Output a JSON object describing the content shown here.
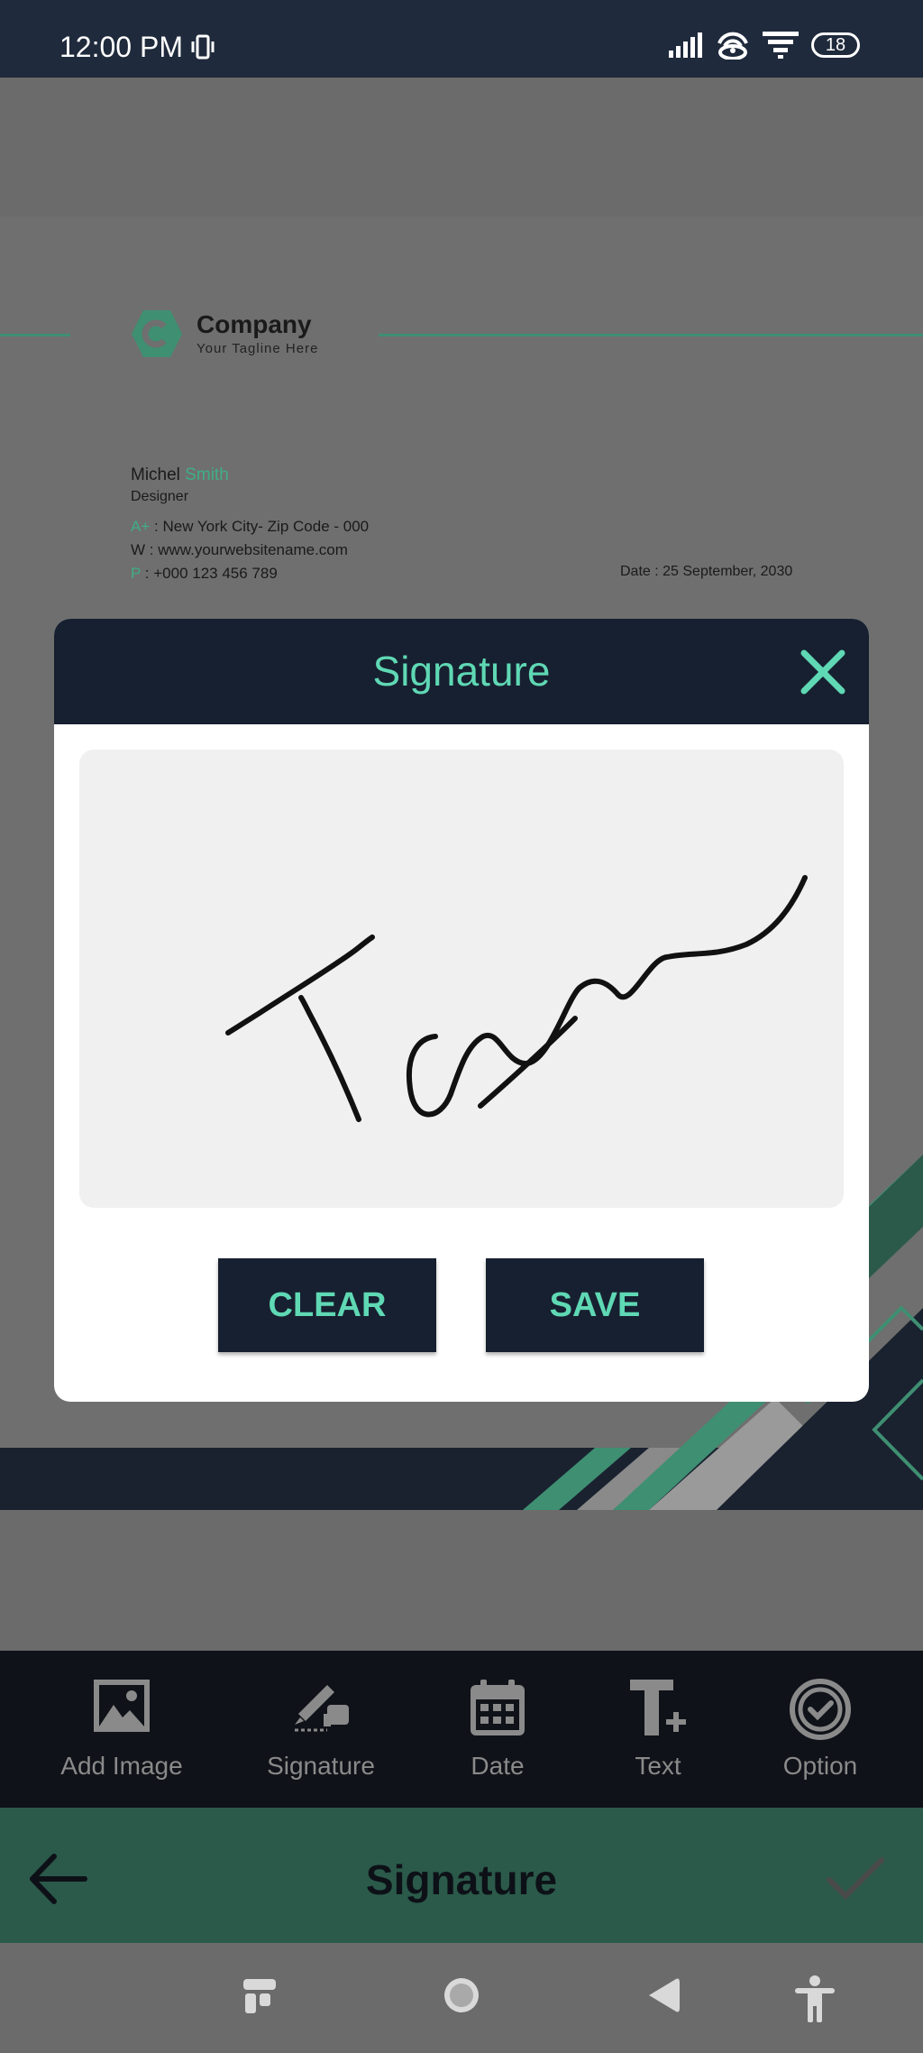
{
  "status_bar": {
    "time": "12:00 PM",
    "battery": "18",
    "icons": [
      "vibrate-icon",
      "signal-icon",
      "hotspot-icon",
      "wifi-icon",
      "battery-icon"
    ]
  },
  "document": {
    "company": "Company",
    "tagline": "Your Tagline Here",
    "name_first": "Michel",
    "name_last": "Smith",
    "role": "Designer",
    "address_key": "A+",
    "address": ": New York City- Zip Code - 000",
    "web_key": "W",
    "web": ": www.yourwebsitename.com",
    "phone_key": "P",
    "phone": ": +000 123 456 789",
    "date": "Date : 25 September, 2030",
    "colors": {
      "accent": "#3fae86",
      "dark": "#1a2230"
    }
  },
  "modal": {
    "title": "Signature",
    "clear_label": "CLEAR",
    "save_label": "SAVE",
    "colors": {
      "header": "#172030",
      "accent": "#5fd8b4"
    }
  },
  "toolbar": {
    "items": [
      {
        "label": "Add Image",
        "icon": "image-icon"
      },
      {
        "label": "Signature",
        "icon": "signature-icon"
      },
      {
        "label": "Date",
        "icon": "calendar-icon"
      },
      {
        "label": "Text",
        "icon": "text-add-icon"
      },
      {
        "label": "Option",
        "icon": "check-circle-icon"
      }
    ]
  },
  "action_bar": {
    "title": "Signature",
    "color": "#2b5a4a"
  },
  "nav_bar": {
    "icons": [
      "recents-icon",
      "home-icon",
      "back-icon",
      "accessibility-icon"
    ]
  }
}
